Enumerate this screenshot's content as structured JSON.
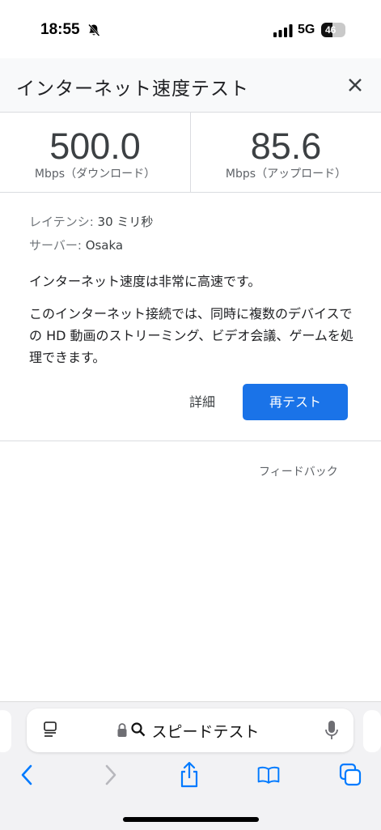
{
  "status_bar": {
    "time": "18:55",
    "network": "5G",
    "battery": "46"
  },
  "header": {
    "title": "インターネット速度テスト"
  },
  "speeds": {
    "download": {
      "value": "500.0",
      "unit": "Mbps（ダウンロード）"
    },
    "upload": {
      "value": "85.6",
      "unit": "Mbps（アップロード）"
    }
  },
  "info": {
    "latency_label": "レイテンシ:",
    "latency_value": "30 ミリ秒",
    "server_label": "サーバー:",
    "server_value": "Osaka",
    "status_message": "インターネット速度は非常に高速です。",
    "description": "このインターネット接続では、同時に複数のデバイスでの HD 動画のストリーミング、ビデオ会議、ゲームを処理できます。"
  },
  "actions": {
    "details": "詳細",
    "retest": "再テスト",
    "feedback": "フィードバック"
  },
  "browser": {
    "address_text": "スピードテスト"
  },
  "colors": {
    "accent": "#1a73e8",
    "ios_blue": "#007aff"
  }
}
